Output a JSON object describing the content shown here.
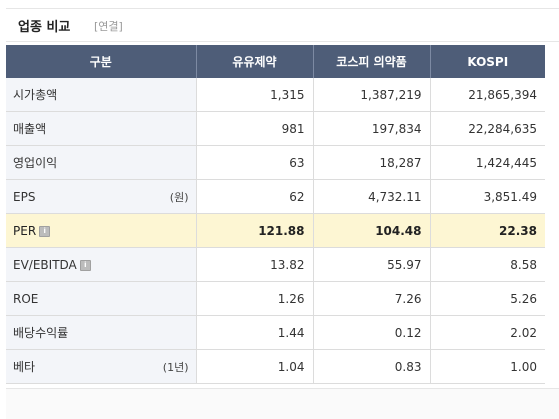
{
  "header": {
    "title": "업종 비교",
    "tag": "[연결]"
  },
  "table": {
    "columns": [
      "구분",
      "유유제약",
      "코스피 의약품",
      "KOSPI"
    ],
    "rows": [
      {
        "label": "시가총액",
        "unit": "",
        "values": [
          "1,315",
          "1,387,219",
          "21,865,394"
        ]
      },
      {
        "label": "매출액",
        "unit": "",
        "values": [
          "981",
          "197,834",
          "22,284,635"
        ]
      },
      {
        "label": "영업이익",
        "unit": "",
        "values": [
          "63",
          "18,287",
          "1,424,445"
        ]
      },
      {
        "label": "EPS",
        "unit": "(원)",
        "values": [
          "62",
          "4,732.11",
          "3,851.49"
        ]
      },
      {
        "label": "PER",
        "unit": "",
        "values": [
          "121.88",
          "104.48",
          "22.38"
        ]
      },
      {
        "label": "EV/EBITDA",
        "unit": "",
        "values": [
          "13.82",
          "55.97",
          "8.58"
        ]
      },
      {
        "label": "ROE",
        "unit": "",
        "values": [
          "1.26",
          "7.26",
          "5.26"
        ]
      },
      {
        "label": "배당수익률",
        "unit": "",
        "values": [
          "1.44",
          "0.12",
          "2.02"
        ]
      },
      {
        "label": "베타",
        "unit": "(1년)",
        "values": [
          "1.04",
          "0.83",
          "1.00"
        ]
      }
    ]
  },
  "icons": {
    "info": "info-icon"
  },
  "colors": {
    "header_bg": "#4e5d78",
    "highlight_row": "#fdf6d3",
    "label_bg": "#f3f5f9"
  }
}
